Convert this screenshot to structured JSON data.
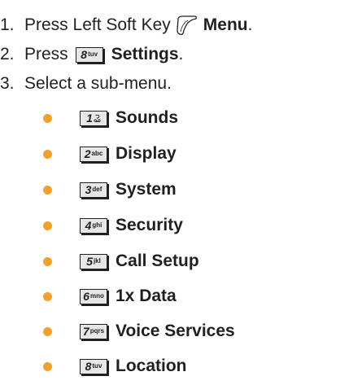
{
  "steps": [
    {
      "num": "1.",
      "prefix": "Press Left Soft Key",
      "icon": "left-soft-key-icon",
      "action": "Menu",
      "suffix": "."
    },
    {
      "num": "2.",
      "prefix": "Press",
      "key": {
        "digit": "8",
        "letters": "tuv"
      },
      "action": "Settings",
      "suffix": "."
    },
    {
      "num": "3.",
      "text": "Select a sub-menu."
    }
  ],
  "submenu": [
    {
      "digit": "1",
      "letters": "",
      "key_icon": "voicemail-icon",
      "label": "Sounds"
    },
    {
      "digit": "2",
      "letters": "abc",
      "label": "Display"
    },
    {
      "digit": "3",
      "letters": "def",
      "label": "System"
    },
    {
      "digit": "4",
      "letters": "ghi",
      "label": "Security"
    },
    {
      "digit": "5",
      "letters": "jkl",
      "label": "Call Setup"
    },
    {
      "digit": "6",
      "letters": "mno",
      "label": "1x Data"
    },
    {
      "digit": "7",
      "letters": "pqrs",
      "label": "Voice Services"
    },
    {
      "digit": "8",
      "letters": "tuv",
      "label": "Location"
    }
  ],
  "colors": {
    "text": "#231f20",
    "bullet": "#f5a02a",
    "key_fill": "#e6e7e8"
  }
}
